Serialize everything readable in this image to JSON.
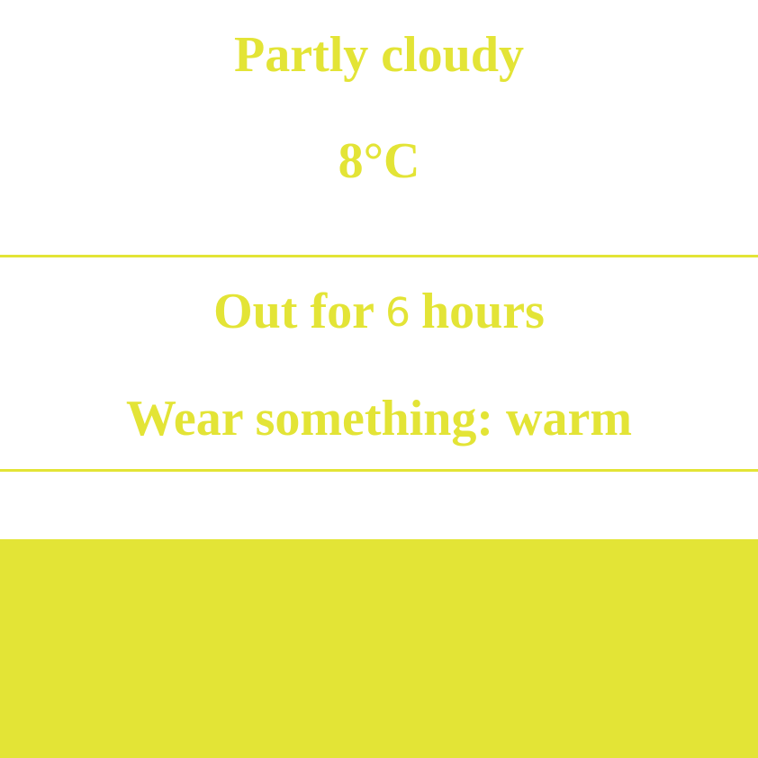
{
  "weather": {
    "condition": "Partly cloudy",
    "temperature": "8°C"
  },
  "plan": {
    "out_prefix": "Out for",
    "hours": "6",
    "out_suffix": "hours",
    "wear_label": "Wear something:",
    "wear_value": "warm"
  },
  "colors": {
    "accent": "#e3e436",
    "background": "#ffffff"
  }
}
